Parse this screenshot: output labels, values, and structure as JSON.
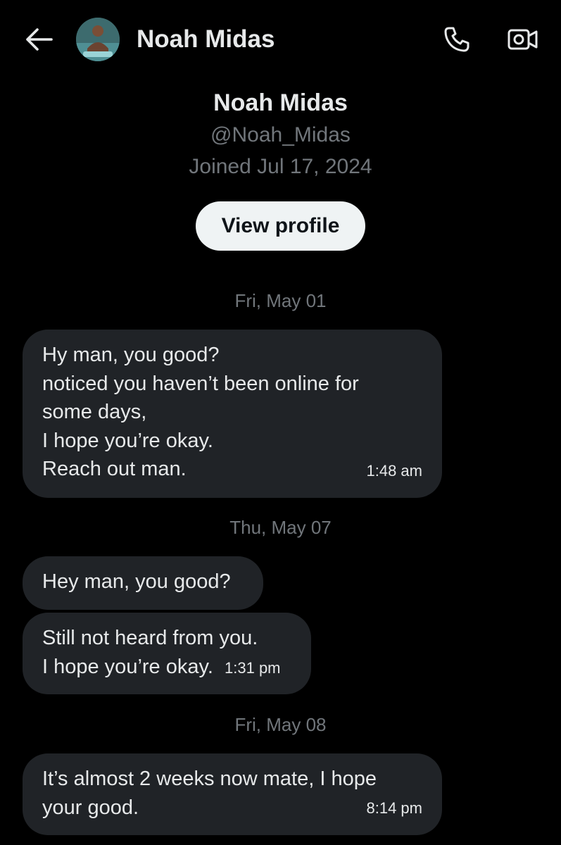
{
  "header": {
    "name": "Noah Midas",
    "back_icon": "arrow-left-icon",
    "call_icon": "phone-icon",
    "video_icon": "video-camera-icon"
  },
  "profile": {
    "name": "Noah Midas",
    "handle": "@Noah_Midas",
    "joined": "Joined Jul 17, 2024",
    "view_profile_label": "View profile"
  },
  "conversation": {
    "groups": [
      {
        "date": "Fri, May 01",
        "messages": [
          {
            "lines": [
              "Hy man, you good?",
              "noticed you haven’t been online for",
              "some days,",
              "I hope you’re okay.",
              "Reach out man."
            ],
            "time": "1:48 am"
          }
        ]
      },
      {
        "date": "Thu, May 07",
        "messages": [
          {
            "lines": [
              "Hey man, you good?"
            ],
            "time": ""
          },
          {
            "lines": [
              "Still not heard from you.",
              "I hope you’re okay."
            ],
            "time": "1:31 pm"
          }
        ]
      },
      {
        "date": "Fri, May 08",
        "messages": [
          {
            "lines": [
              "It’s almost 2 weeks now mate, I hope",
              "your good."
            ],
            "time": "8:14 pm"
          }
        ]
      }
    ]
  },
  "colors": {
    "background": "#000000",
    "bubble": "#202327",
    "text": "#e7e9ea",
    "muted": "#71767b",
    "button_bg": "#eff3f4",
    "button_text": "#0f1419"
  }
}
